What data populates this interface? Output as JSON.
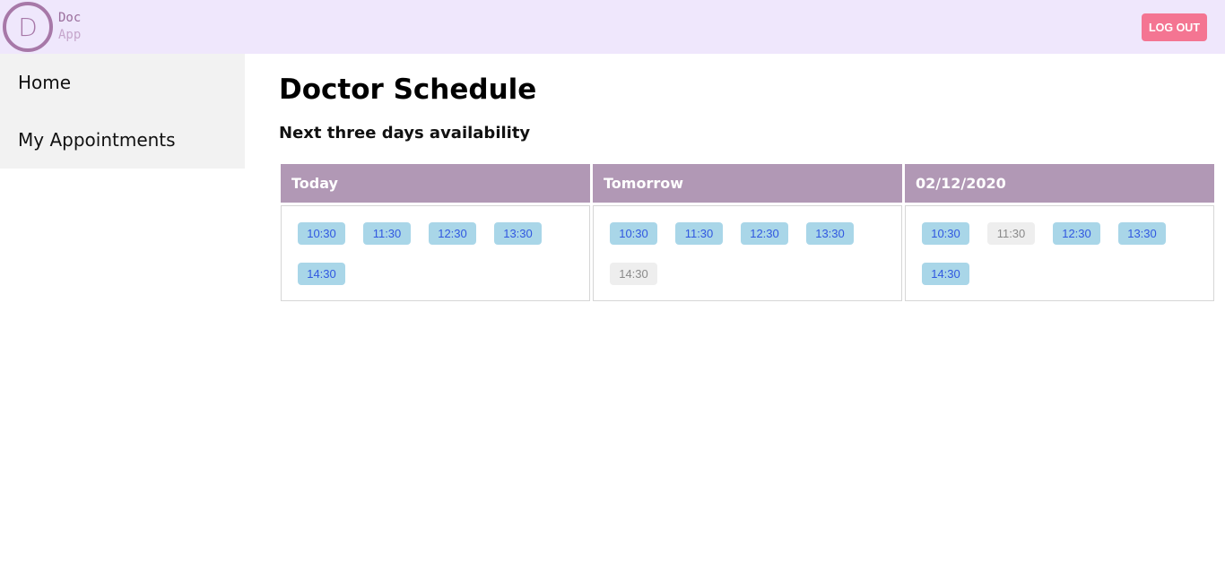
{
  "header": {
    "logo_letter": "D",
    "logo_line1": "Doc",
    "logo_line2": "App",
    "logout_label": "LOG OUT"
  },
  "sidebar": {
    "items": [
      {
        "label": "Home"
      },
      {
        "label": "My Appointments"
      }
    ]
  },
  "main": {
    "title": "Doctor Schedule",
    "subtitle": "Next three days availability",
    "days": [
      {
        "label": "Today",
        "slots": [
          {
            "time": "10:30",
            "status": "available"
          },
          {
            "time": "11:30",
            "status": "available"
          },
          {
            "time": "12:30",
            "status": "available"
          },
          {
            "time": "13:30",
            "status": "available"
          },
          {
            "time": "14:30",
            "status": "available"
          }
        ]
      },
      {
        "label": "Tomorrow",
        "slots": [
          {
            "time": "10:30",
            "status": "available"
          },
          {
            "time": "11:30",
            "status": "available"
          },
          {
            "time": "12:30",
            "status": "available"
          },
          {
            "time": "13:30",
            "status": "available"
          },
          {
            "time": "14:30",
            "status": "booked"
          }
        ]
      },
      {
        "label": "02/12/2020",
        "slots": [
          {
            "time": "10:30",
            "status": "available"
          },
          {
            "time": "11:30",
            "status": "booked"
          },
          {
            "time": "12:30",
            "status": "available"
          },
          {
            "time": "13:30",
            "status": "available"
          },
          {
            "time": "14:30",
            "status": "available"
          }
        ]
      }
    ]
  },
  "colors": {
    "header_bg": "#efe7fc",
    "logo": "#a778a8",
    "logout_bg": "#f47592",
    "sidebar_bg": "#f2f2f2",
    "day_header_bg": "#b198b5",
    "slot_available_bg": "#a9d6e8",
    "slot_available_text": "#3158e0",
    "slot_booked_bg": "#eeeeee",
    "slot_booked_text": "#8a8a8a"
  }
}
